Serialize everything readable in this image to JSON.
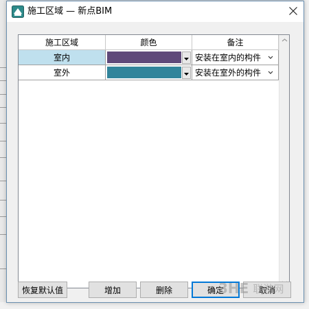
{
  "window": {
    "title": "施工区域 — 新点BIM",
    "icons": {
      "app": "bim-app-icon",
      "close": "close-icon"
    }
  },
  "table": {
    "columns": [
      "施工区域",
      "颜色",
      "备注"
    ],
    "rows": [
      {
        "area": "室内",
        "color": "#5f497a",
        "note": "安装在室内的构件",
        "selected": true
      },
      {
        "area": "室外",
        "color": "#31849b",
        "note": "安装在室外的构件",
        "selected": false
      }
    ]
  },
  "buttons": {
    "restore_default": "恢复默认值",
    "add": "增加",
    "delete": "删除",
    "ok": "确定",
    "cancel": "取消"
  },
  "watermark": {
    "logo": "3HE",
    "text": "联游网"
  },
  "colors": {
    "accent": "#0078d7",
    "selected_row": "#bfe0ee",
    "dialog_bg": "#f0f0f0"
  }
}
